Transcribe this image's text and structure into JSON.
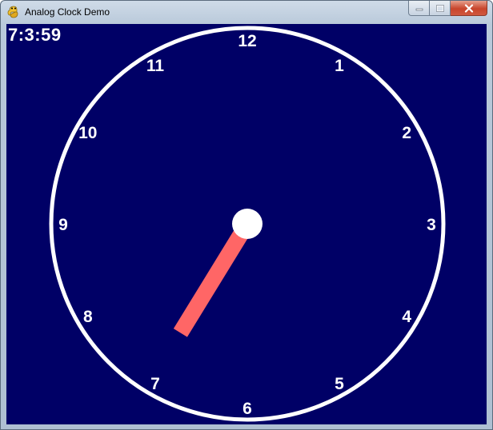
{
  "window": {
    "title": "Analog Clock Demo",
    "icon": "python-icon",
    "controls": [
      "minimize-icon",
      "maximize-icon",
      "close-icon"
    ]
  },
  "clock": {
    "digital_time": "7:3:59",
    "hour": 7,
    "minute": 3,
    "second": 59,
    "numerals": [
      "12",
      "1",
      "2",
      "3",
      "4",
      "5",
      "6",
      "7",
      "8",
      "9",
      "10",
      "11"
    ],
    "face_color": "#000066",
    "ring_color": "#ffffff",
    "hand_color": "#ff6666",
    "hub_color": "#ffffff"
  }
}
